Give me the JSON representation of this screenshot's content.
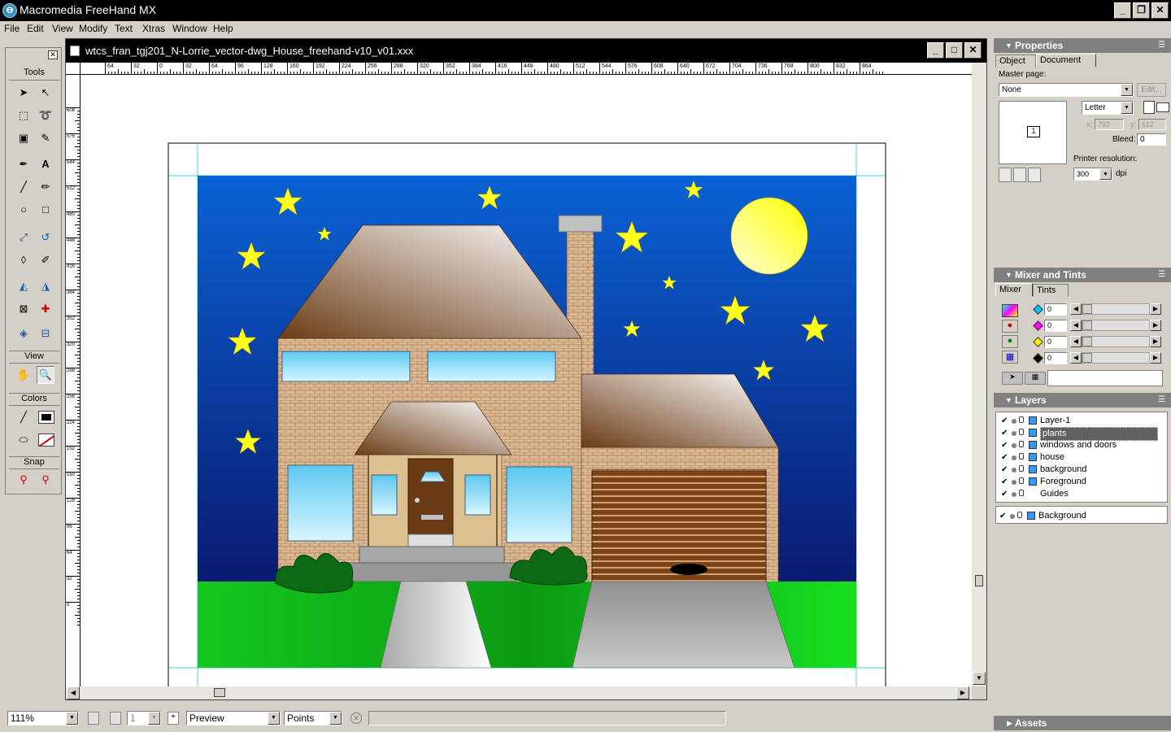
{
  "app": {
    "title": "Macromedia FreeHand MX",
    "logo_letter": "Ɵ"
  },
  "menu": [
    "File",
    "Edit",
    "View",
    "Modify",
    "Text",
    "Xtras",
    "Window",
    "Help"
  ],
  "document": {
    "title": "wtcs_fran_tgj201_N-Lorrie_vector-dwg_House_freehand-v10_v01.xxx"
  },
  "ruler_h": [
    "64",
    "32",
    "0",
    "32",
    "64",
    "96",
    "128",
    "160",
    "192",
    "224",
    "256",
    "288",
    "320",
    "352",
    "384",
    "416",
    "448",
    "480",
    "512",
    "544",
    "576",
    "608",
    "640",
    "672",
    "704",
    "736",
    "768",
    "800",
    "832",
    "864"
  ],
  "ruler_v": [
    "608",
    "576",
    "544",
    "512",
    "480",
    "448",
    "416",
    "384",
    "352",
    "320",
    "288",
    "256",
    "224",
    "192",
    "160",
    "128",
    "96",
    "64",
    "32",
    "0"
  ],
  "toolbox": {
    "tools_label": "Tools",
    "view_label": "View",
    "colors_label": "Colors",
    "snap_label": "Snap"
  },
  "status": {
    "zoom": "111%",
    "page": "1",
    "view_mode": "Preview",
    "units": "Points"
  },
  "properties": {
    "title": "Properties",
    "tab_object": "Object",
    "tab_document": "Document",
    "master_page_label": "Master page:",
    "master_page_value": "None",
    "edit_button": "Edit...",
    "page_size": "Letter",
    "x_label": "x:",
    "x_value": "792",
    "y_label": "y:",
    "y_value": "612",
    "bleed_label": "Bleed:",
    "bleed_value": "0",
    "page_thumb": "1",
    "printer_res_label": "Printer resolution:",
    "printer_res_value": "300",
    "dpi_label": "dpi"
  },
  "mixer": {
    "title": "Mixer and Tints",
    "tab_mixer": "Mixer",
    "tab_tints": "Tints",
    "channels": [
      {
        "color": "#00c0ff",
        "value": "0"
      },
      {
        "color": "#ff00ff",
        "value": "0"
      },
      {
        "color": "#ffee00",
        "value": "0"
      },
      {
        "color": "#000000",
        "value": "0"
      }
    ]
  },
  "layers": {
    "title": "Layers",
    "items": [
      "Layer-1",
      "plants",
      "windows and doors",
      "house",
      "background",
      "Foreground",
      "Guides"
    ],
    "selected": "plants",
    "background_layer": "Background"
  },
  "assets": {
    "title": "Assets"
  },
  "colors": {
    "sky_top": "#0a5fd1",
    "sky_bottom": "#0a1e78",
    "grass": "#0fb81a",
    "star": "#ffff1a",
    "brick": "#d9b28c",
    "roof": "#6b3d1a"
  }
}
